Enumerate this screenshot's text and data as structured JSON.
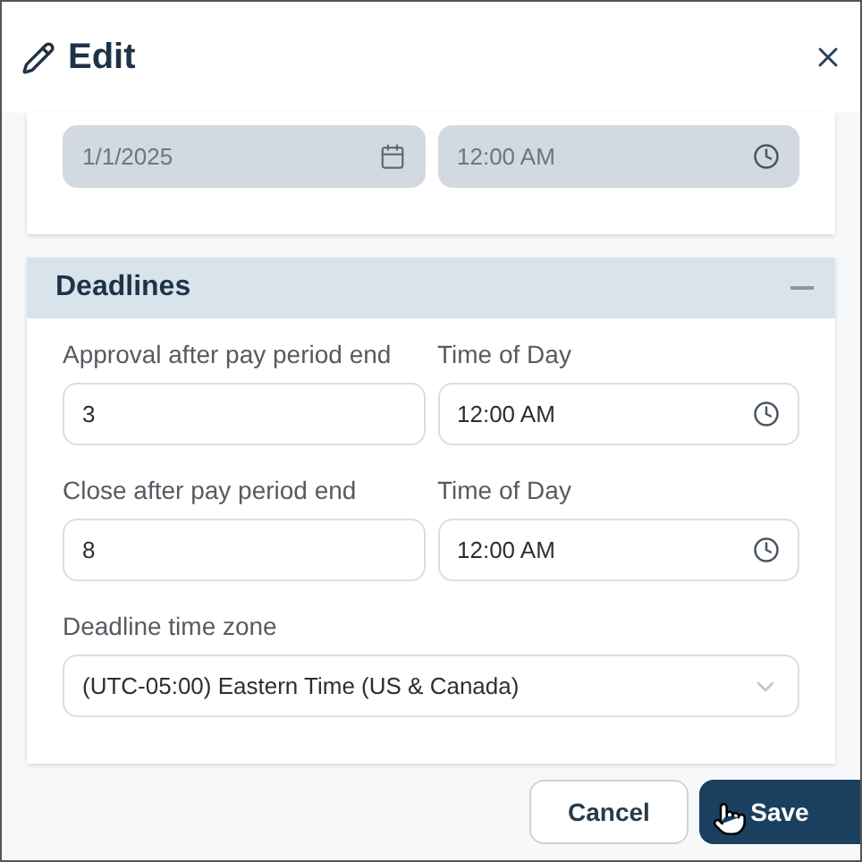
{
  "window": {
    "title": "Edit"
  },
  "top_fields": [
    {
      "kind": "date",
      "value": "1/1/2025",
      "disabled": true
    },
    {
      "kind": "time",
      "value": "12:00 AM",
      "disabled": true
    }
  ],
  "section": {
    "title": "Deadlines",
    "expanded": true,
    "rows": [
      {
        "fields": [
          {
            "kind": "number",
            "label": "Approval after pay period end",
            "value": "3",
            "disabled": false
          },
          {
            "kind": "time",
            "label": "Time of Day",
            "value": "12:00 AM",
            "disabled": false
          }
        ]
      },
      {
        "fields": [
          {
            "kind": "number",
            "label": "Close after pay period end",
            "value": "8",
            "disabled": false
          },
          {
            "kind": "time",
            "label": "Time of Day",
            "value": "12:00 AM",
            "disabled": false
          }
        ]
      },
      {
        "fields": [
          {
            "kind": "select",
            "label": "Deadline time zone",
            "value": "(UTC-05:00) Eastern Time (US & Canada)",
            "disabled": false
          }
        ]
      }
    ]
  },
  "buttons": [
    {
      "kind": "secondary",
      "label": "Cancel"
    },
    {
      "kind": "primary",
      "label": "Save"
    }
  ]
}
